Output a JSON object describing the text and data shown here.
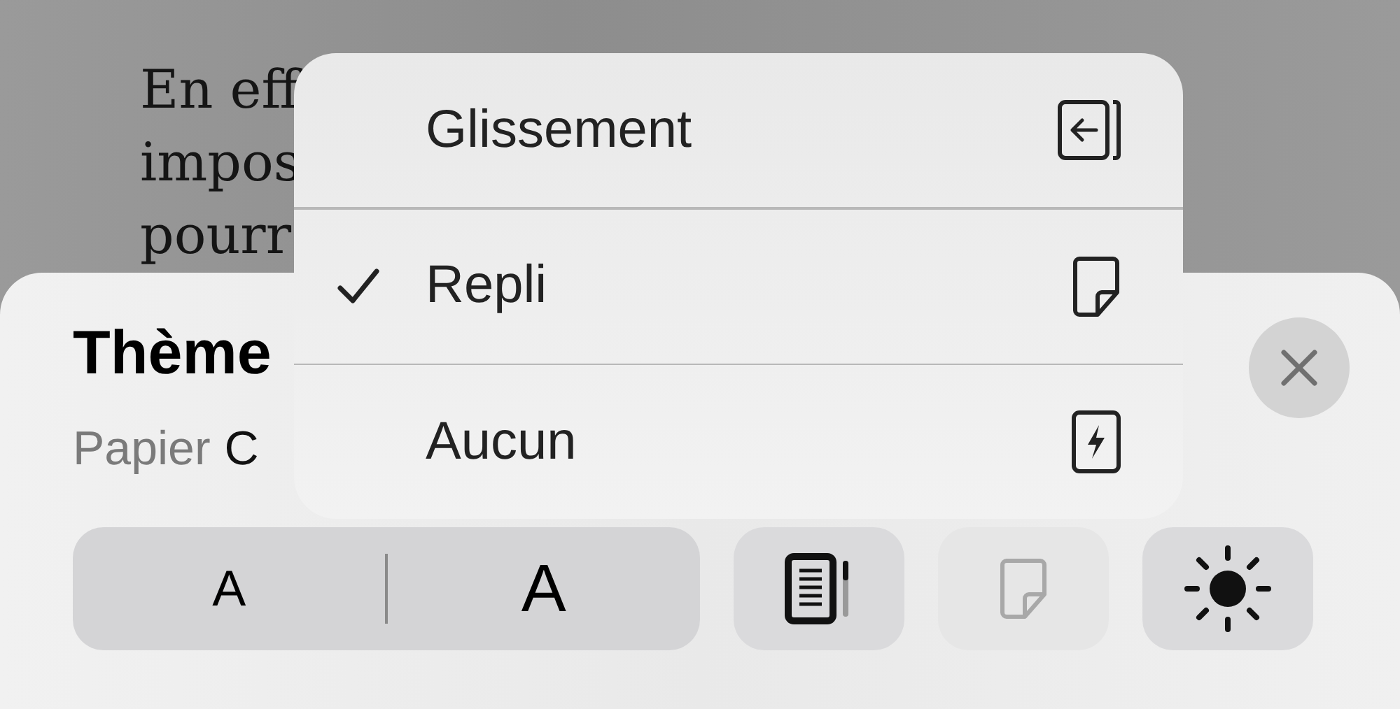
{
  "book_text": {
    "lines": [
      "En eff",
      "impos",
      "pourr"
    ]
  },
  "theme_sheet": {
    "title": "Thème",
    "subtitle": [
      {
        "text": "Papier",
        "muted": true
      },
      {
        "text": "C",
        "muted": false
      }
    ]
  },
  "toolbar": {
    "font_size": [
      {
        "label": "A",
        "kind": "small"
      },
      {
        "label": "A",
        "kind": "large"
      }
    ],
    "buttons": [
      {
        "kind": "scroll",
        "disabled": false
      },
      {
        "kind": "curl",
        "disabled": true
      },
      {
        "kind": "brightness",
        "disabled": false
      }
    ]
  },
  "transition_menu": {
    "items": [
      {
        "label": "Glissement",
        "kind": "slide",
        "selected": false
      },
      {
        "label": "Repli",
        "kind": "curl",
        "selected": true
      },
      {
        "label": "Aucun",
        "kind": "none",
        "selected": false
      }
    ]
  }
}
